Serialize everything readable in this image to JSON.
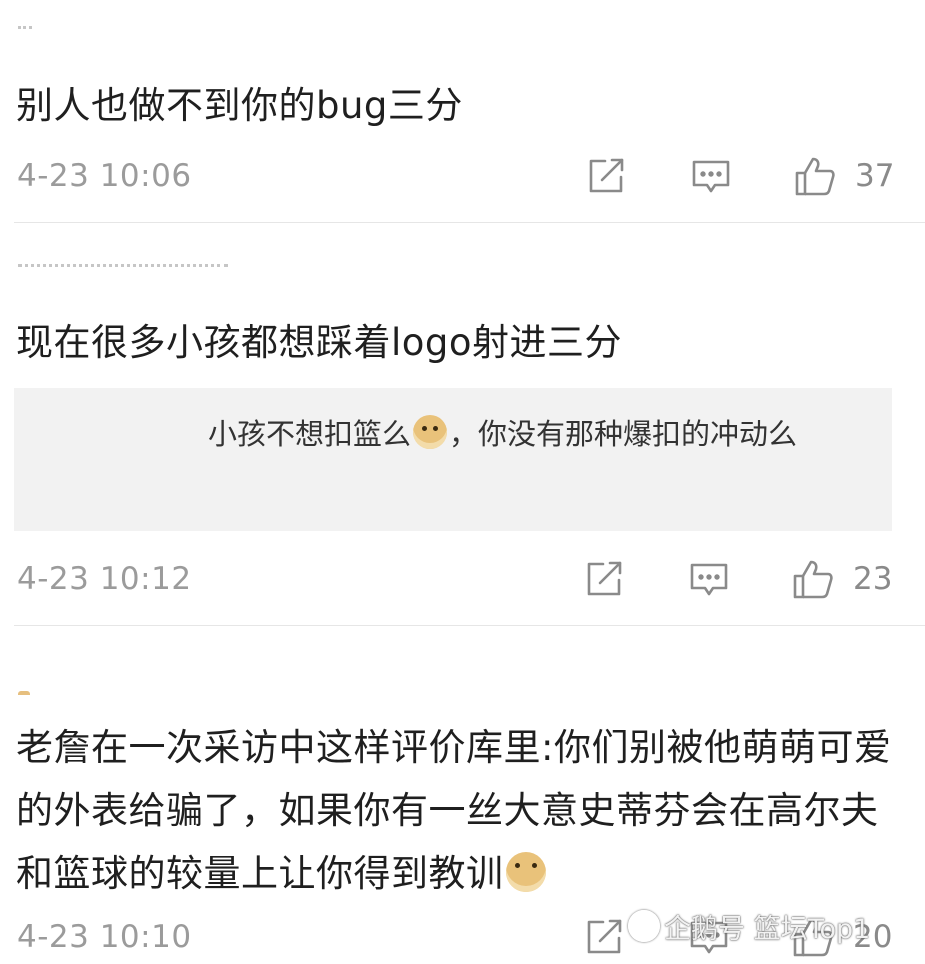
{
  "comments": [
    {
      "text": "别人也做不到你的bug三分",
      "time": "4-23 10:06",
      "likes": "37"
    },
    {
      "text": "现在很多小孩都想踩着logo射进三分",
      "reply": {
        "text_a": "小孩不想扣篮么",
        "emoji": "doge-emoji",
        "text_b": "，你没有那种爆扣的冲动么"
      },
      "time": "4-23 10:12",
      "likes": "23"
    },
    {
      "text": "老詹在一次采访中这样评价库里:你们别被他萌萌可爱的外表给骗了，如果你有一丝大意史蒂芬会在高尔夫和篮球的较量上让你得到教训",
      "emoji": "doge-emoji",
      "time": "4-23 10:10",
      "likes": "20"
    }
  ],
  "icons": {
    "share": "share-icon",
    "reply": "comment-icon",
    "like": "thumbs-up-icon"
  },
  "watermark": {
    "text": "企鹅号 篮坛Top1"
  },
  "colors": {
    "text": "#1f1f1f",
    "meta": "#9b9b9b",
    "reply_bg": "#f2f2f2",
    "divider": "#e6e6e6"
  }
}
